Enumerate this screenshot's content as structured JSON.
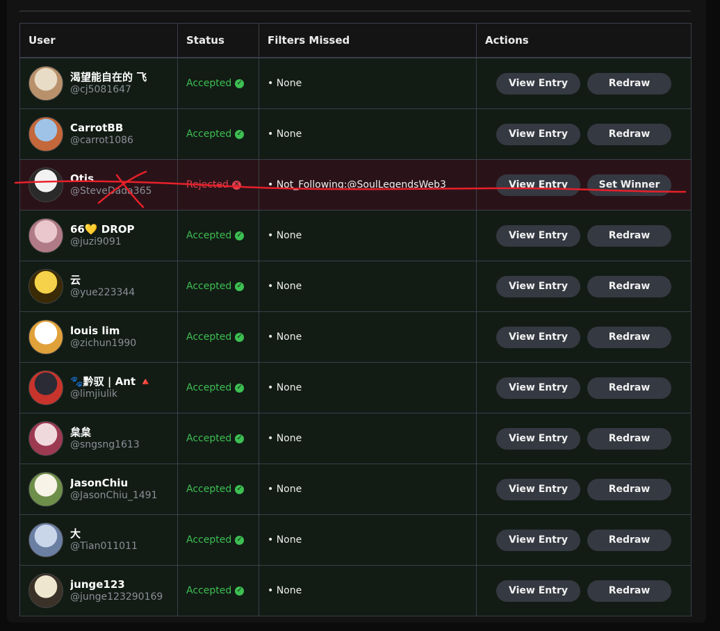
{
  "table": {
    "headers": {
      "user": "User",
      "status": "Status",
      "filters": "Filters Missed",
      "actions": "Actions"
    },
    "rows": [
      {
        "name": "渴望能自在的 飞",
        "handle": "@cj5081647",
        "status": "Accepted",
        "state": "accepted",
        "filters": "• None",
        "primary_action": "View Entry",
        "secondary_action": "Redraw",
        "avatar_colors": [
          "#e9dcc6",
          "#b8916c"
        ]
      },
      {
        "name": "CarrotBB",
        "handle": "@carrot1086",
        "status": "Accepted",
        "state": "accepted",
        "filters": "• None",
        "primary_action": "View Entry",
        "secondary_action": "Redraw",
        "avatar_colors": [
          "#9ec3e6",
          "#c4673a"
        ]
      },
      {
        "name": "Otis",
        "handle": "@SteveDada365",
        "status": "Rejected",
        "state": "rejected",
        "filters": "• Not_Following:@SoulLegendsWeb3",
        "primary_action": "View Entry",
        "secondary_action": "Set Winner",
        "avatar_colors": [
          "#f2f2f2",
          "#2a2a2a"
        ]
      },
      {
        "name": "66💛 DROP",
        "handle": "@juzi9091",
        "status": "Accepted",
        "state": "accepted",
        "filters": "• None",
        "primary_action": "View Entry",
        "secondary_action": "Redraw",
        "avatar_colors": [
          "#e9c7cd",
          "#b07a86"
        ]
      },
      {
        "name": "云",
        "handle": "@yue223344",
        "status": "Accepted",
        "state": "accepted",
        "filters": "• None",
        "primary_action": "View Entry",
        "secondary_action": "Redraw",
        "avatar_colors": [
          "#f5d24a",
          "#3a2a05"
        ]
      },
      {
        "name": "louis lim",
        "handle": "@zichun1990",
        "status": "Accepted",
        "state": "accepted",
        "filters": "• None",
        "primary_action": "View Entry",
        "secondary_action": "Redraw",
        "avatar_colors": [
          "#ffffff",
          "#e0a13a"
        ]
      },
      {
        "name": "🐾黔驭 | Ant 🔺",
        "handle": "@limjiulik",
        "status": "Accepted",
        "state": "accepted",
        "filters": "• None",
        "primary_action": "View Entry",
        "secondary_action": "Redraw",
        "avatar_colors": [
          "#2b2b36",
          "#c8342b"
        ]
      },
      {
        "name": "枲枲",
        "handle": "@sngsng1613",
        "status": "Accepted",
        "state": "accepted",
        "filters": "• None",
        "primary_action": "View Entry",
        "secondary_action": "Redraw",
        "avatar_colors": [
          "#f0d9dd",
          "#9c3a52"
        ]
      },
      {
        "name": "JasonChiu",
        "handle": "@JasonChiu_1491",
        "status": "Accepted",
        "state": "accepted",
        "filters": "• None",
        "primary_action": "View Entry",
        "secondary_action": "Redraw",
        "avatar_colors": [
          "#f7f3e6",
          "#6e8f4a"
        ]
      },
      {
        "name": "大",
        "handle": "@Tian011011",
        "status": "Accepted",
        "state": "accepted",
        "filters": "• None",
        "primary_action": "View Entry",
        "secondary_action": "Redraw",
        "avatar_colors": [
          "#c9d6ea",
          "#6b7fa3"
        ]
      },
      {
        "name": "junge123",
        "handle": "@junge123290169",
        "status": "Accepted",
        "state": "accepted",
        "filters": "• None",
        "primary_action": "View Entry",
        "secondary_action": "Redraw",
        "avatar_colors": [
          "#efe6cf",
          "#3a3128"
        ]
      }
    ]
  },
  "colors": {
    "accepted": "#3dbf52",
    "rejected": "#e0434f",
    "annotation": "#e8202a"
  },
  "icons": {
    "accepted": "check-circle-icon",
    "rejected": "x-circle-icon"
  }
}
